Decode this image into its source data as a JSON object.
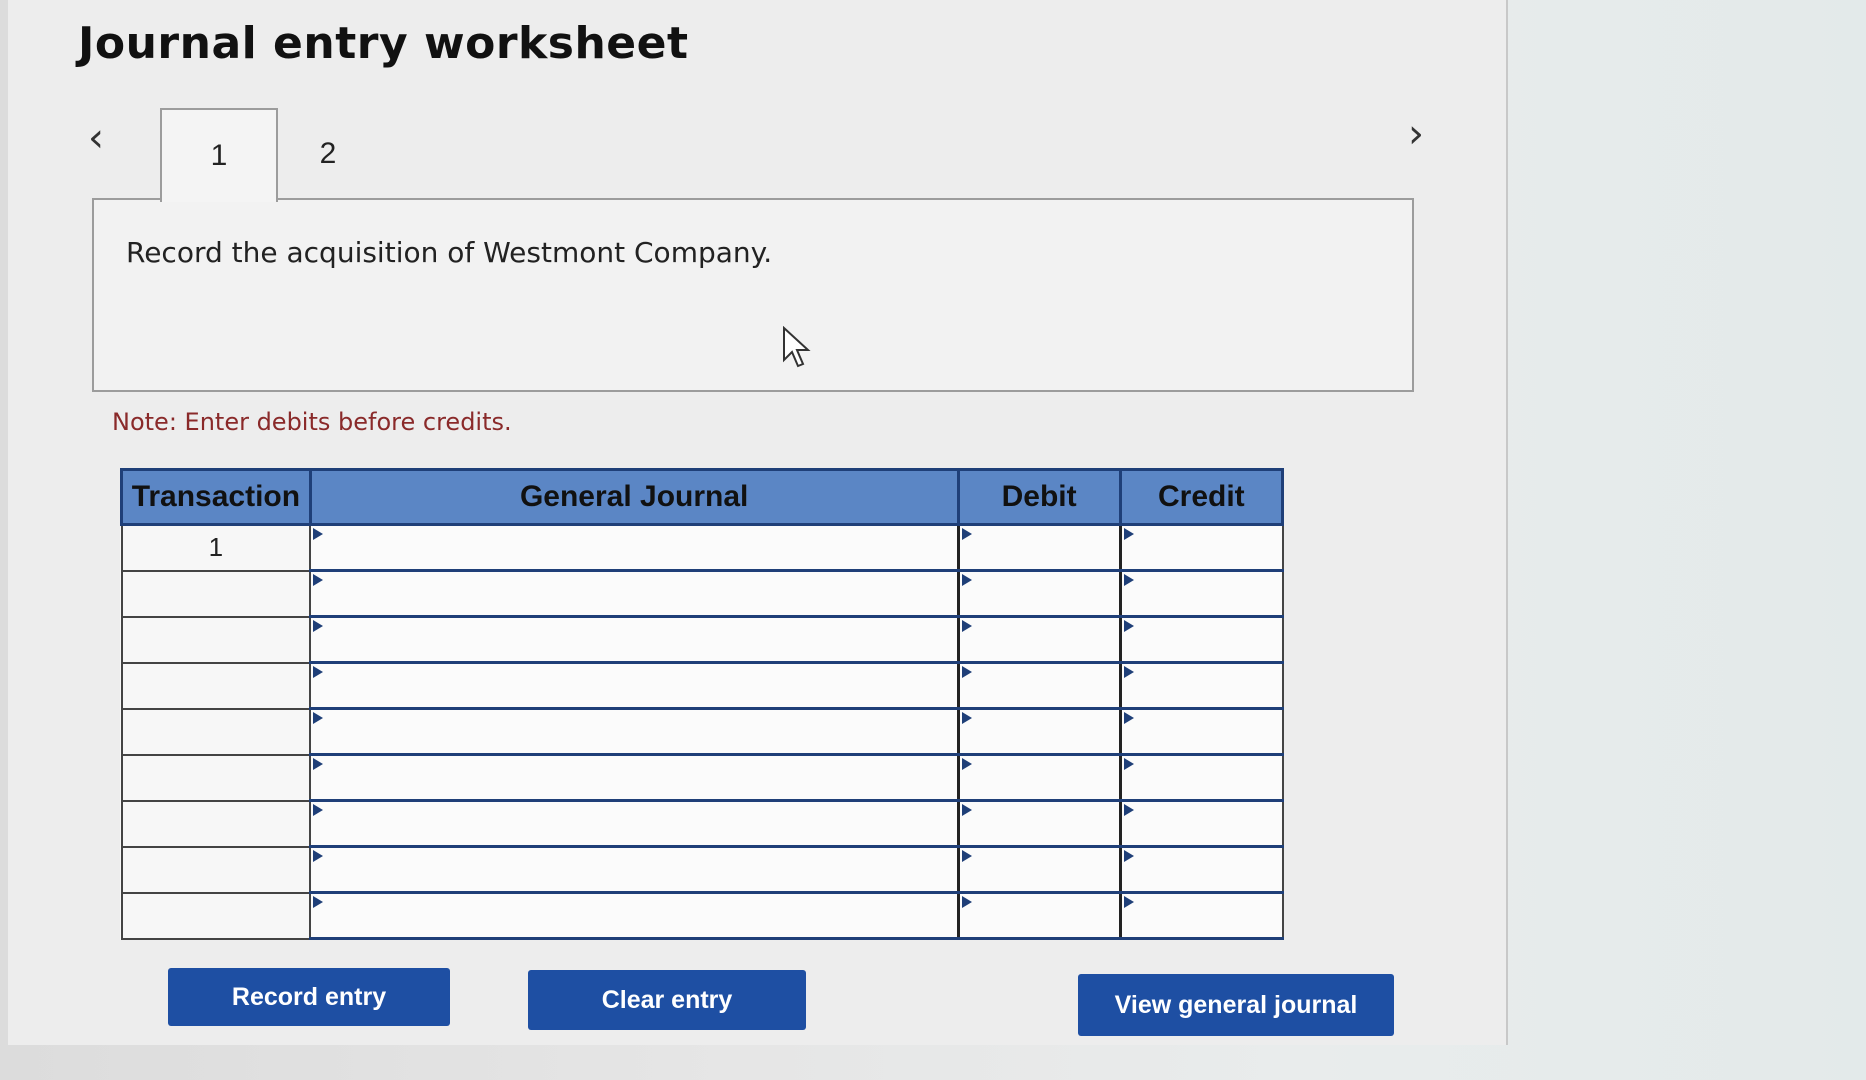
{
  "header": {
    "title": "Journal entry worksheet"
  },
  "nav": {
    "prev_icon": "chevron-left-icon",
    "next_icon": "chevron-right-icon",
    "prev_glyph": "‹",
    "next_glyph": "›"
  },
  "tabs": [
    {
      "label": "1",
      "active": true
    },
    {
      "label": "2",
      "active": false
    }
  ],
  "content": {
    "instruction": "Record the acquisition of Westmont Company."
  },
  "note": "Note: Enter debits before credits.",
  "table": {
    "headers": [
      "Transaction",
      "General Journal",
      "Debit",
      "Credit"
    ],
    "rows": [
      {
        "transaction": "1",
        "general_journal": "",
        "debit": "",
        "credit": ""
      },
      {
        "transaction": "",
        "general_journal": "",
        "debit": "",
        "credit": ""
      },
      {
        "transaction": "",
        "general_journal": "",
        "debit": "",
        "credit": ""
      },
      {
        "transaction": "",
        "general_journal": "",
        "debit": "",
        "credit": ""
      },
      {
        "transaction": "",
        "general_journal": "",
        "debit": "",
        "credit": ""
      },
      {
        "transaction": "",
        "general_journal": "",
        "debit": "",
        "credit": ""
      },
      {
        "transaction": "",
        "general_journal": "",
        "debit": "",
        "credit": ""
      },
      {
        "transaction": "",
        "general_journal": "",
        "debit": "",
        "credit": ""
      },
      {
        "transaction": "",
        "general_journal": "",
        "debit": "",
        "credit": ""
      }
    ]
  },
  "buttons": {
    "record": "Record entry",
    "clear": "Clear entry",
    "view": "View general journal"
  },
  "colors": {
    "header_blue": "#5b86c5",
    "button_blue": "#1e4fa3",
    "note_red": "#8a2a2a"
  }
}
